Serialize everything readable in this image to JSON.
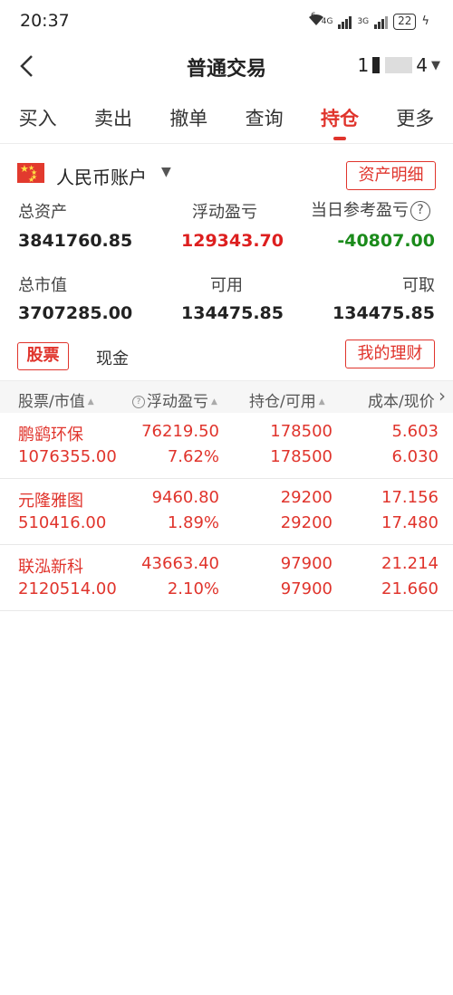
{
  "status_bar": {
    "time": "20:37",
    "network1": "4G",
    "network2": "3G",
    "battery": "22",
    "wifi": "6"
  },
  "nav": {
    "title": "普通交易",
    "account_prefix": "1",
    "account_suffix": "4"
  },
  "tabs": [
    {
      "label": "买入",
      "active": false
    },
    {
      "label": "卖出",
      "active": false
    },
    {
      "label": "撤单",
      "active": false
    },
    {
      "label": "查询",
      "active": false
    },
    {
      "label": "持仓",
      "active": true
    },
    {
      "label": "更多",
      "active": false
    }
  ],
  "account": {
    "currency": "人民币账户",
    "asset_detail_button": "资产明细",
    "total_assets_label": "总资产",
    "total_assets": "3841760.85",
    "floating_pl_label": "浮动盈亏",
    "floating_pl": "129343.70",
    "daily_pl_label": "当日参考盈亏",
    "daily_pl": "-40807.00",
    "market_value_label": "总市值",
    "market_value": "3707285.00",
    "available_label": "可用",
    "available": "134475.85",
    "withdrawable_label": "可取",
    "withdrawable": "134475.85"
  },
  "subtabs": {
    "stocks": "股票",
    "cash": "现金",
    "wealth_button": "我的理财"
  },
  "table": {
    "headers": [
      "股票/市值",
      "浮动盈亏",
      "持仓/可用",
      "成本/现价"
    ],
    "rows": [
      {
        "name": "鹏鹞环保",
        "market_value": "1076355.00",
        "pl": "76219.50",
        "pl_pct": "7.62%",
        "position": "178500",
        "available": "178500",
        "cost": "5.603",
        "price": "6.030"
      },
      {
        "name": "元隆雅图",
        "market_value": "510416.00",
        "pl": "9460.80",
        "pl_pct": "1.89%",
        "position": "29200",
        "available": "29200",
        "cost": "17.156",
        "price": "17.480"
      },
      {
        "name": "联泓新科",
        "market_value": "2120514.00",
        "pl": "43663.40",
        "pl_pct": "2.10%",
        "position": "97900",
        "available": "97900",
        "cost": "21.214",
        "price": "21.660"
      }
    ]
  },
  "colors": {
    "accent": "#e0342c",
    "profit": "#dd1f1f",
    "loss": "#1b8b1b"
  }
}
